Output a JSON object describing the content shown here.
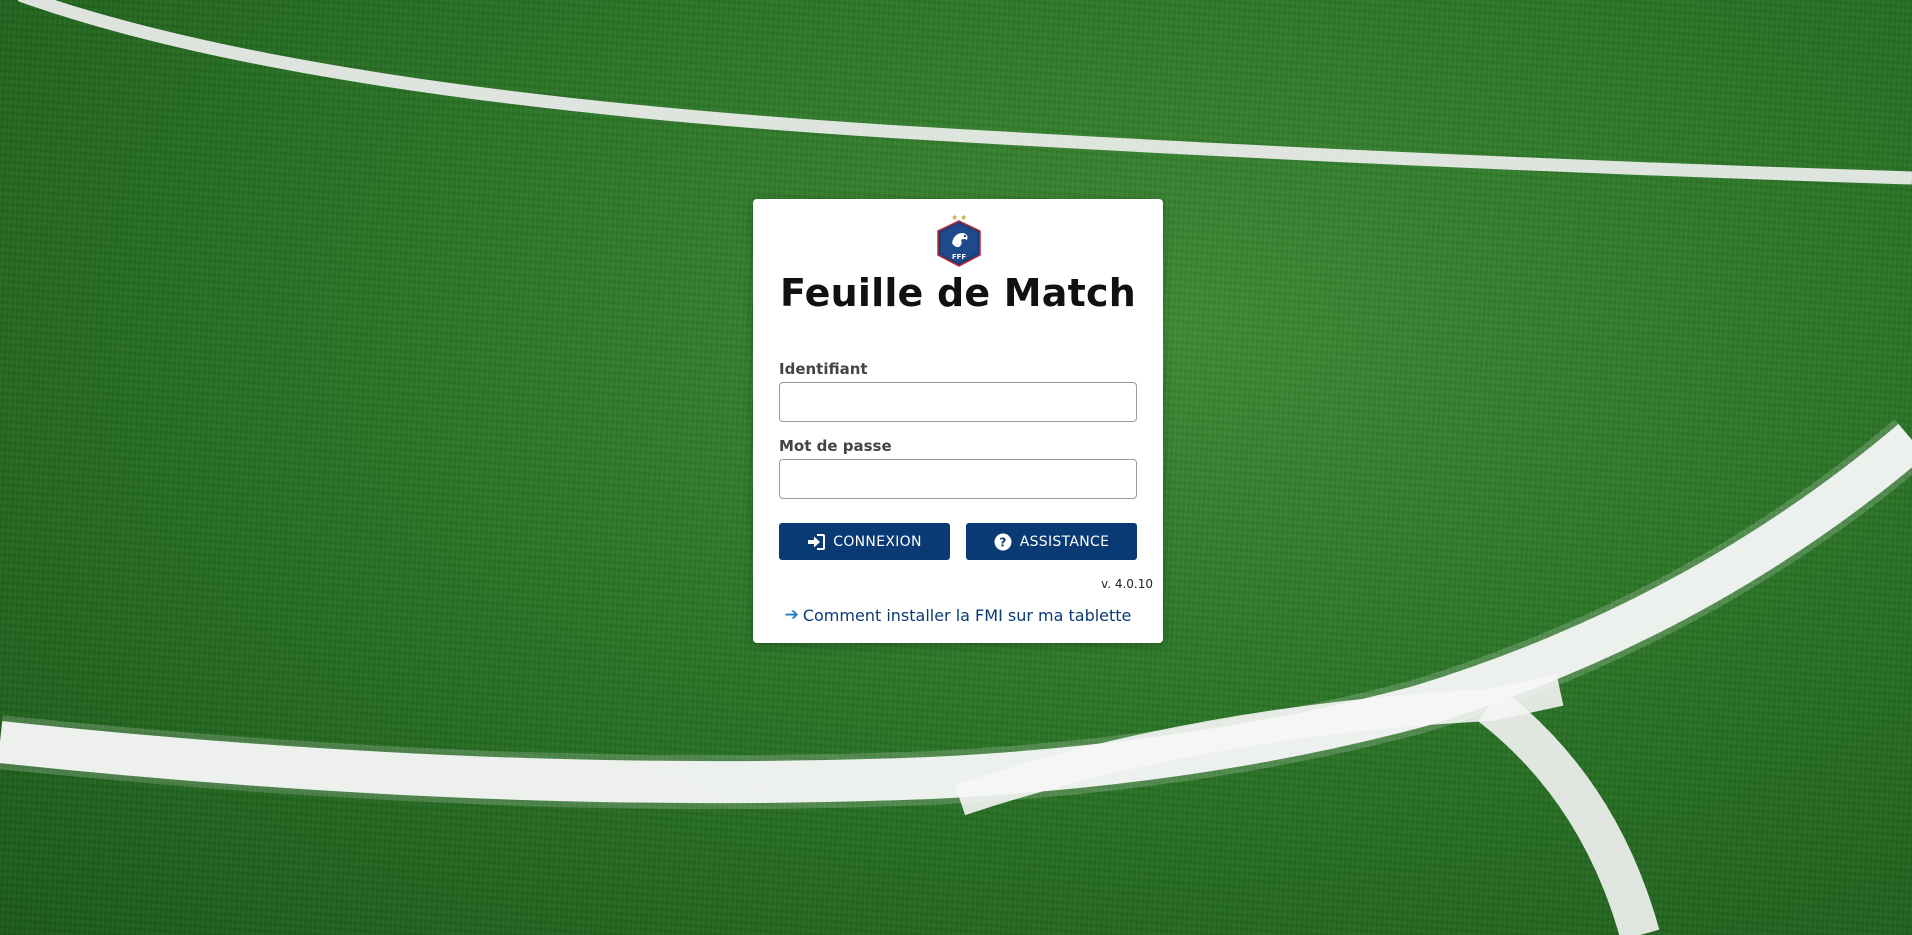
{
  "app": {
    "title": "Feuille de Match"
  },
  "logo": {
    "icon": "fff-crest-icon",
    "text": "FFF"
  },
  "form": {
    "identifiant_label": "Identifiant",
    "identifiant_value": "",
    "password_label": "Mot de passe",
    "password_value": ""
  },
  "buttons": {
    "login_label": "CONNEXION",
    "login_icon": "sign-in-icon",
    "help_label": "ASSISTANCE",
    "help_icon": "question-circle-icon"
  },
  "version": "v. 4.0.10",
  "install_link": {
    "label": "Comment installer la FMI sur ma tablette",
    "icon": "arrow-right-icon"
  },
  "colors": {
    "primary": "#0a3a73",
    "link_arrow": "#1f7fc0",
    "card_bg": "#ffffff",
    "grass": "#2f7a2a",
    "line": "#f2f2f2"
  }
}
